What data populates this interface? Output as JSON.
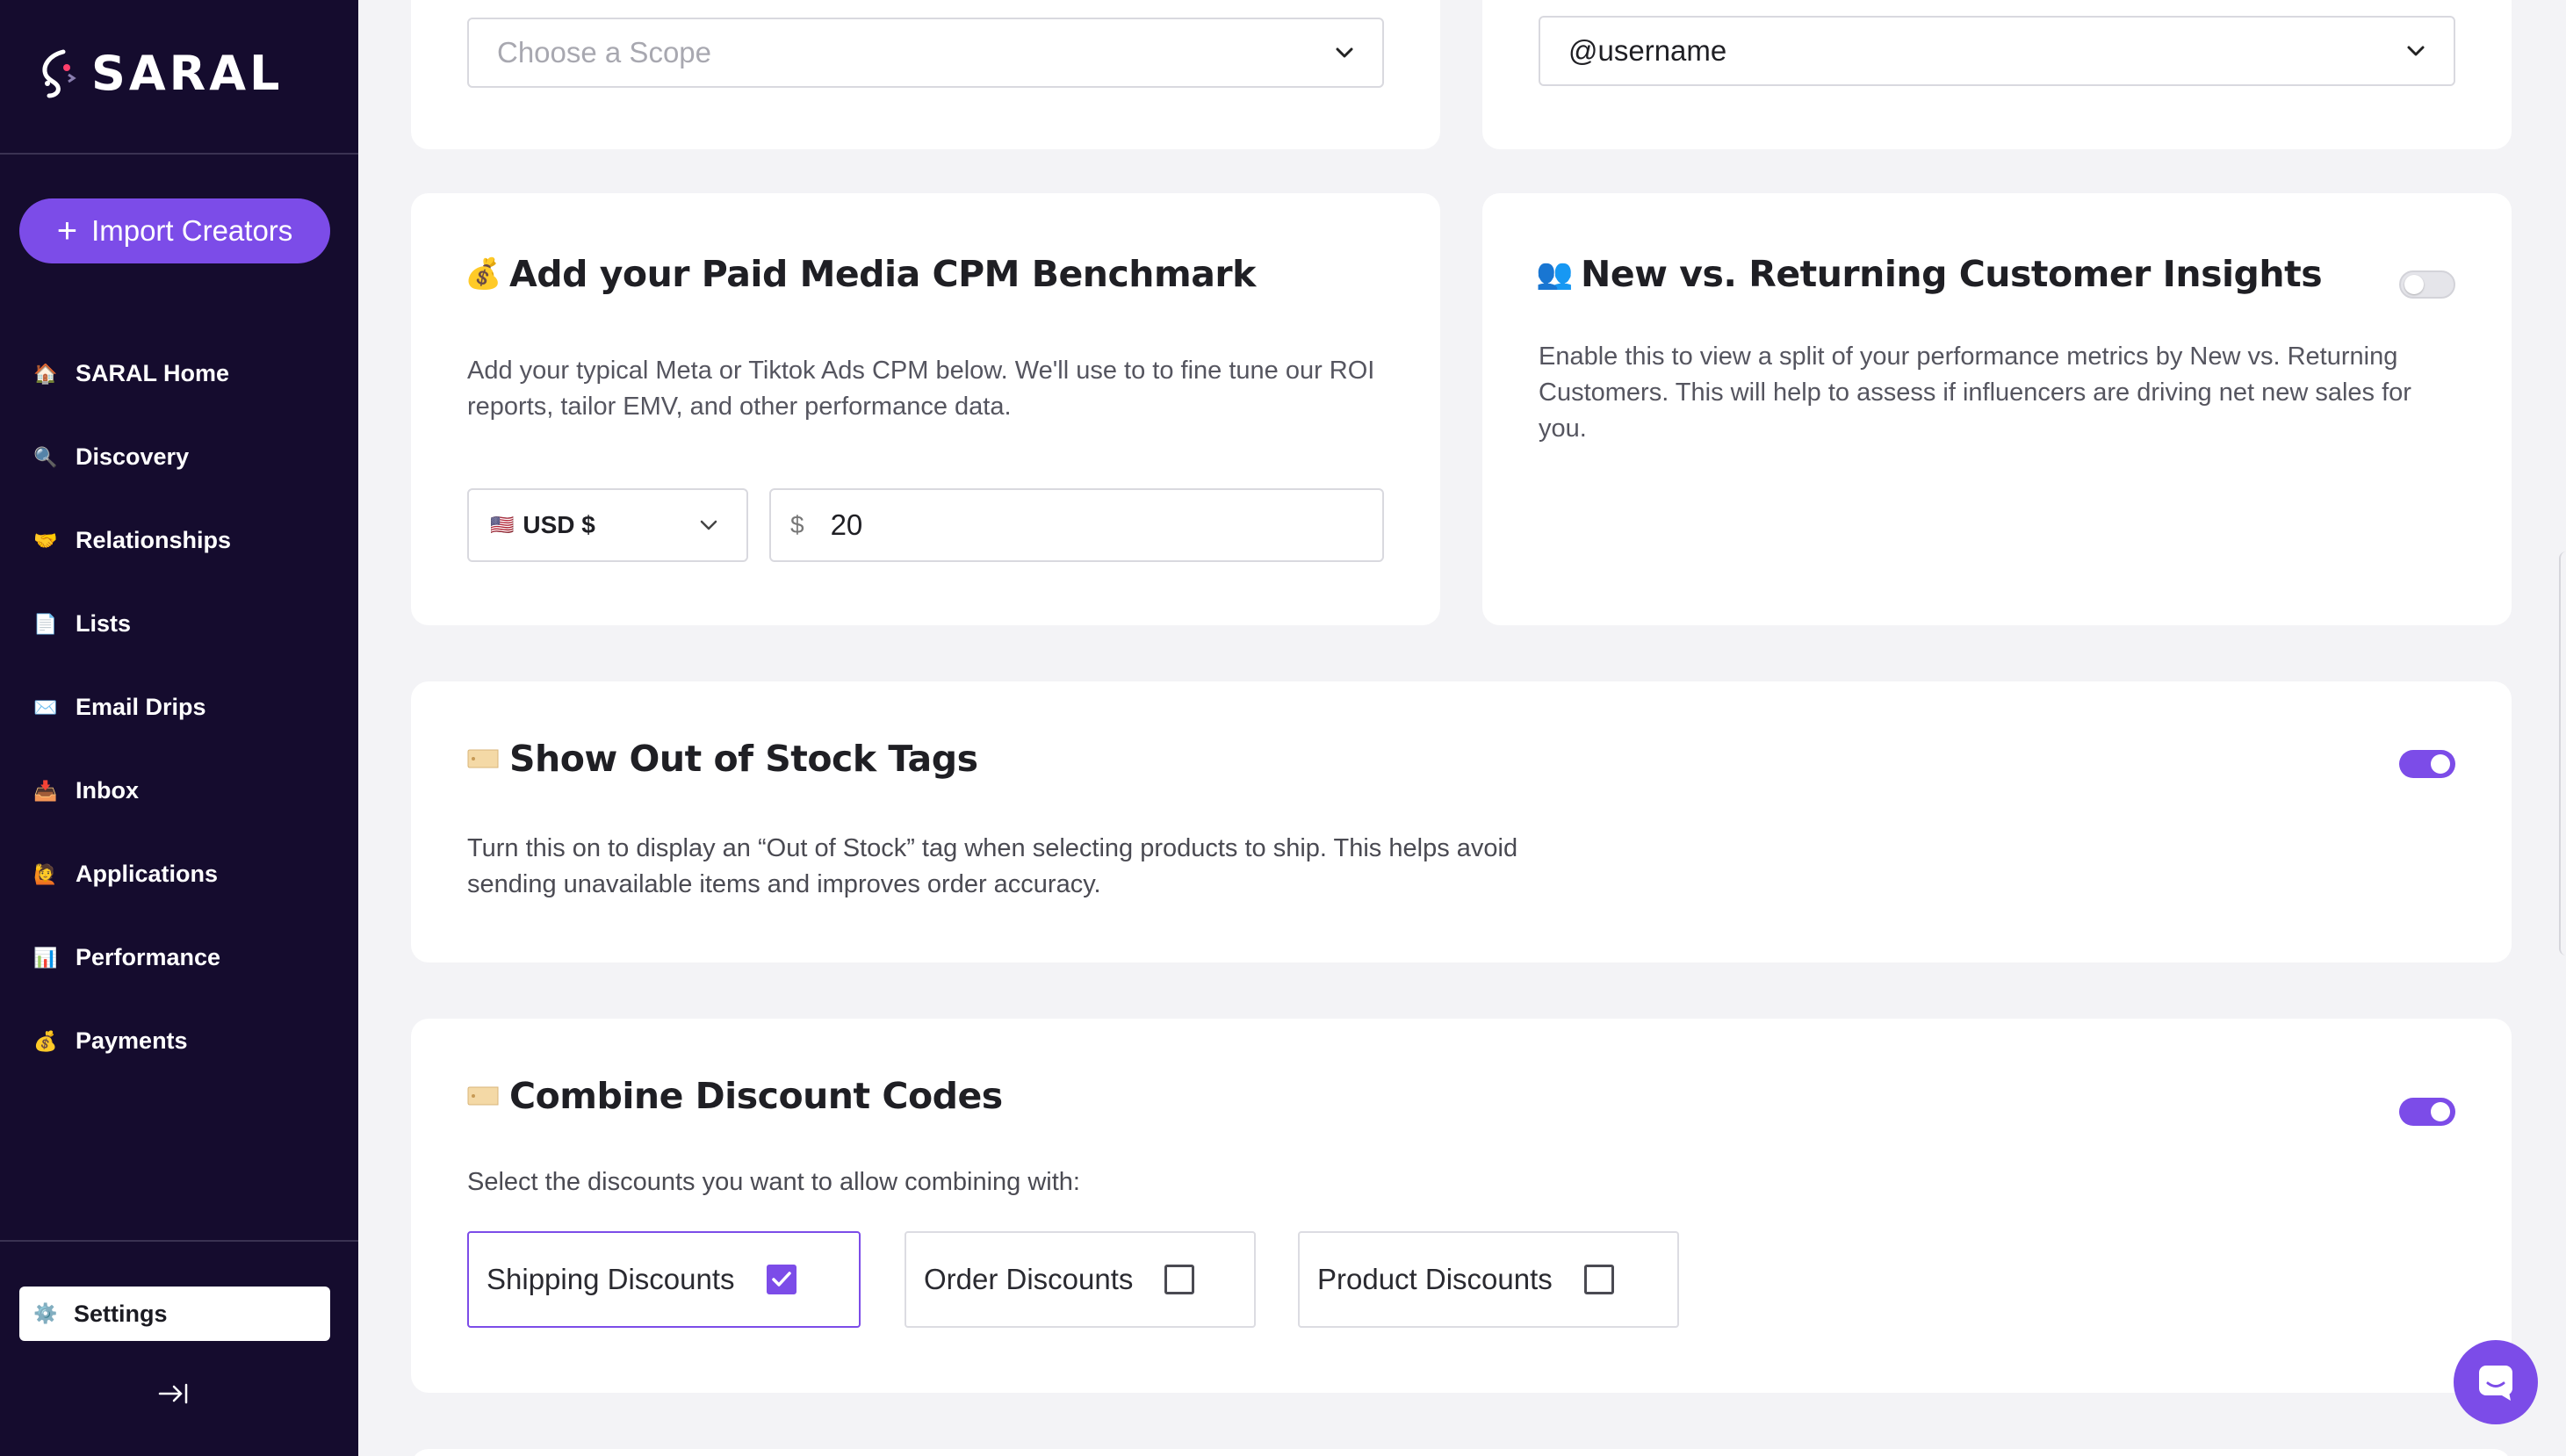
{
  "brand": {
    "name": "SARAL",
    "accent": "#7c4ce8",
    "logo_red": "#ff3f6c",
    "sidebar_bg": "#150c2e"
  },
  "sidebar": {
    "import_button": "Import Creators",
    "items": [
      {
        "label": "SARAL Home",
        "icon": "house-icon",
        "glyph": "🏠"
      },
      {
        "label": "Discovery",
        "icon": "magnifier-icon",
        "glyph": "🔍"
      },
      {
        "label": "Relationships",
        "icon": "handshake-icon",
        "glyph": "🤝"
      },
      {
        "label": "Lists",
        "icon": "document-icon",
        "glyph": "📄"
      },
      {
        "label": "Email Drips",
        "icon": "envelope-icon",
        "glyph": "✉️"
      },
      {
        "label": "Inbox",
        "icon": "inbox-tray-icon",
        "glyph": "📥"
      },
      {
        "label": "Applications",
        "icon": "person-icon",
        "glyph": "🙋"
      },
      {
        "label": "Performance",
        "icon": "bar-chart-icon",
        "glyph": "📊"
      },
      {
        "label": "Payments",
        "icon": "money-bag-icon",
        "glyph": "💰"
      }
    ],
    "settings": {
      "label": "Settings",
      "icon": "gear-icon",
      "glyph": "⚙️"
    },
    "collapse_icon": "collapse-arrow-icon"
  },
  "top_left": {
    "scope_select": {
      "placeholder": "Choose a Scope"
    }
  },
  "top_right": {
    "username_select": {
      "value": "@username"
    }
  },
  "cpm": {
    "emoji": "💰",
    "title": "Add your Paid Media CPM Benchmark",
    "description": "Add your typical Meta or Tiktok Ads CPM below. We'll use to to fine tune our ROI reports, tailor EMV, and other performance data.",
    "currency": {
      "flag": "🇺🇸",
      "value": "USD $"
    },
    "amount": {
      "prefix": "$",
      "value": "20"
    }
  },
  "new_returning": {
    "emoji": "👥",
    "title": "New vs. Returning Customer Insights",
    "description": "Enable this to view a split of your performance metrics by New vs. Returning Customers. This will help to assess if influencers are driving net new sales for you.",
    "enabled": false
  },
  "out_of_stock": {
    "emoji": "🏷️",
    "title": "Show Out of Stock Tags",
    "description": "Turn this on to display an “Out of Stock” tag when selecting products to ship. This helps avoid sending unavailable items and improves order accuracy.",
    "enabled": true
  },
  "combine_discounts": {
    "emoji": "🏷️",
    "title": "Combine Discount Codes",
    "description": "Select the discounts you want to allow combining with:",
    "enabled": true,
    "options": [
      {
        "label": "Shipping Discounts",
        "checked": true
      },
      {
        "label": "Order Discounts",
        "checked": false
      },
      {
        "label": "Product Discounts",
        "checked": false
      }
    ]
  }
}
